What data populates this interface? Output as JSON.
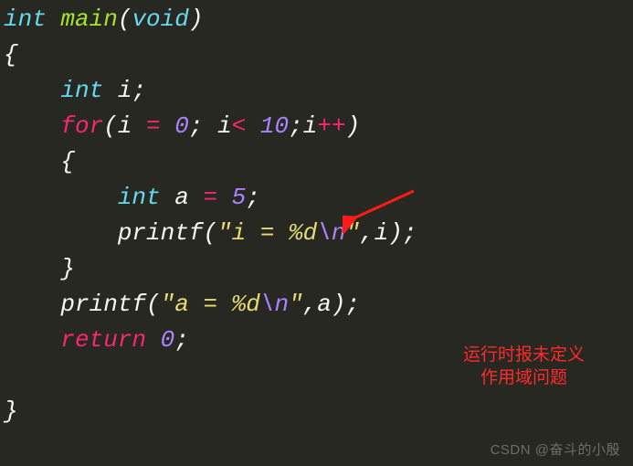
{
  "code": {
    "l1_kw1": "int",
    "l1_fn": "main",
    "l1_p1": "(",
    "l1_kw2": "void",
    "l1_p2": ")",
    "l2": "{",
    "l3_pad": "    ",
    "l3_kw": "int",
    "l3_rest": " i;",
    "l4_pad": "    ",
    "l4_ctl": "for",
    "l4_a": "(i ",
    "l4_eq": "=",
    "l4_b": " ",
    "l4_n0": "0",
    "l4_c": "; i",
    "l4_lt": "<",
    "l4_d": " ",
    "l4_n10": "10",
    "l4_e": ";i",
    "l4_pp": "++",
    "l4_f": ")",
    "l5_pad": "    ",
    "l5": "{",
    "l6_pad": "        ",
    "l6_kw": "int",
    "l6_a": " a ",
    "l6_eq": "=",
    "l6_b": " ",
    "l6_n5": "5",
    "l6_c": ";",
    "l7_pad": "        ",
    "l7_a": "printf(",
    "l7_s1": "\"i = %d",
    "l7_esc": "\\n",
    "l7_s2": "\"",
    "l7_b": ",i);",
    "l8_pad": "    ",
    "l8": "}",
    "l9_pad": "    ",
    "l9_a": "printf(",
    "l9_s1": "\"a = %d",
    "l9_esc": "\\n",
    "l9_s2": "\"",
    "l9_b": ",a);",
    "l10_pad": "    ",
    "l10_ctl": "return",
    "l10_a": " ",
    "l10_n": "0",
    "l10_b": ";",
    "l12": "}"
  },
  "annotation": {
    "line1": "运行时报未定义",
    "line2": "作用域问题"
  },
  "watermark": "CSDN @奋斗的小殷"
}
